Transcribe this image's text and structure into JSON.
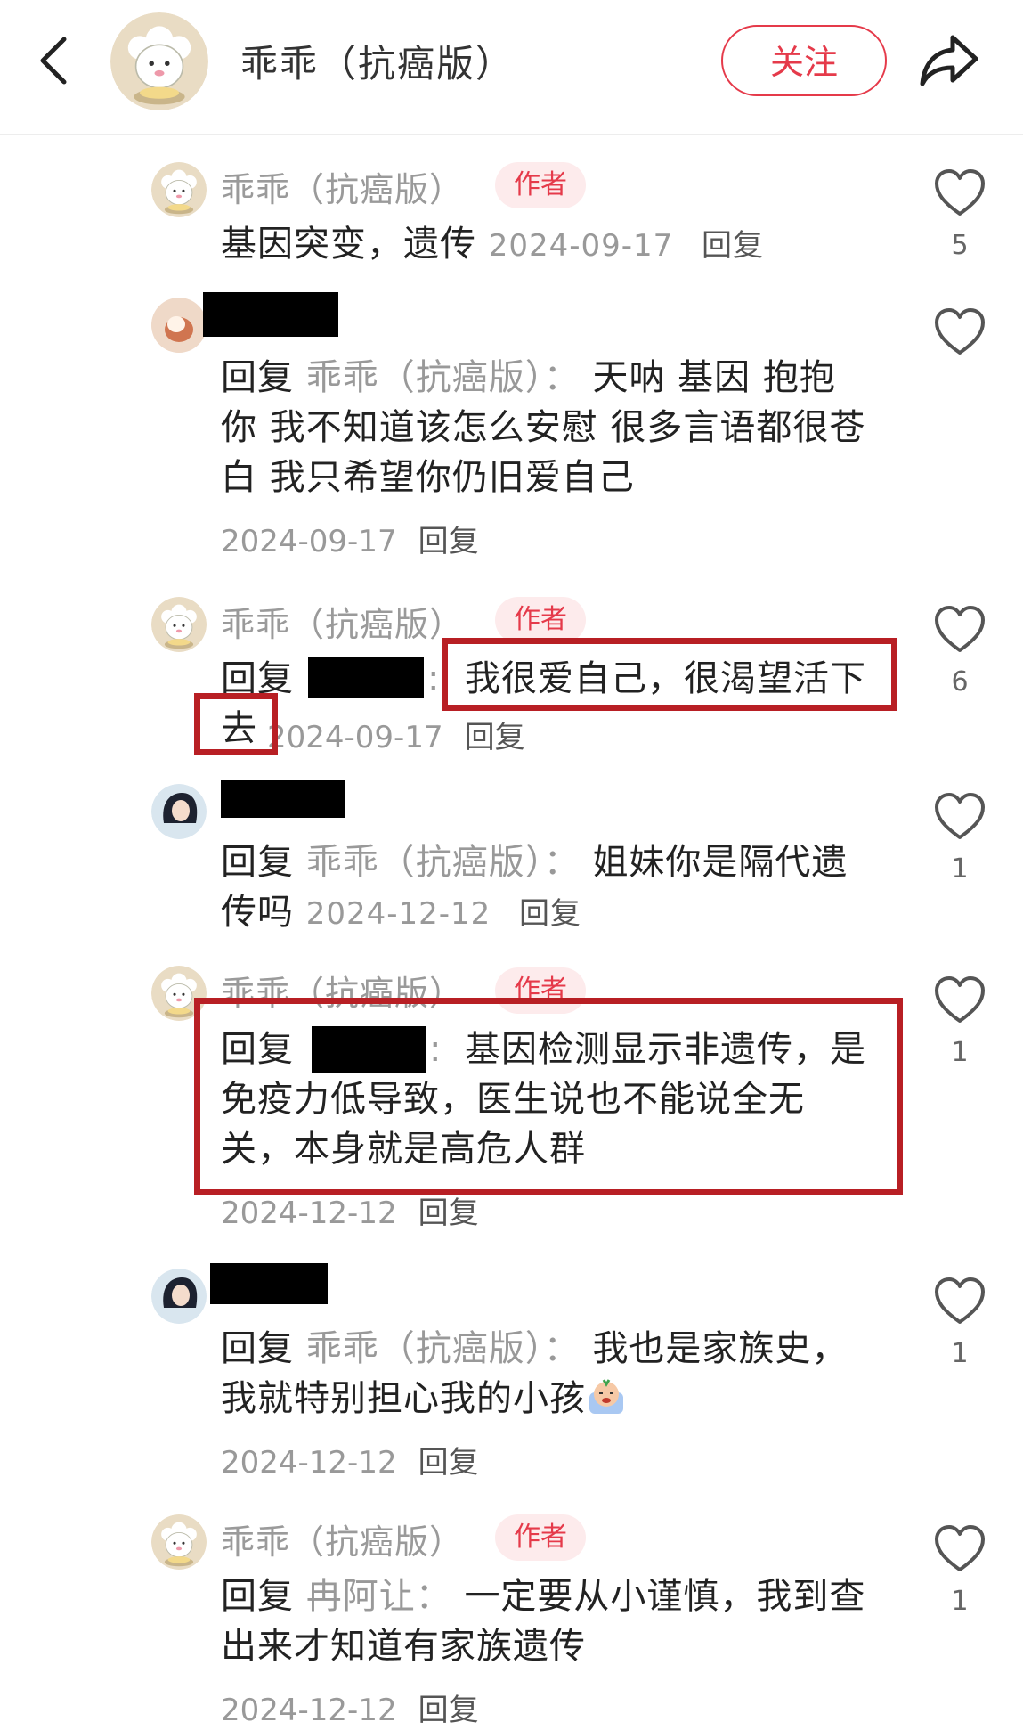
{
  "header": {
    "title": "乖乖（抗癌版）",
    "follow_label": "关注"
  },
  "comments": [
    {
      "author": "乖乖（抗癌版）",
      "tag": "作者",
      "text": "基因突变，遗传",
      "date": "2024-09-17",
      "reply_label": "回复",
      "likes": "5"
    },
    {
      "reply_prefix": "回复",
      "mention": "乖乖（抗癌版）",
      "lines": [
        "天呐 基因 抱抱",
        "你 我不知道该怎么安慰 很多言语都很苍",
        "白 我只希望你仍旧爱自己"
      ],
      "date": "2024-09-17",
      "reply_label": "回复"
    },
    {
      "author": "乖乖（抗癌版）",
      "tag": "作者",
      "reply_prefix": "回复",
      "line1": "我很爱自己，很渴望活下",
      "line2": "去",
      "date": "2024-09-17",
      "reply_label": "回复",
      "likes": "6"
    },
    {
      "reply_prefix": "回复",
      "mention": "乖乖（抗癌版）",
      "line1": "姐妹你是隔代遗",
      "line2": "传吗",
      "date": "2024-12-12",
      "reply_label": "回复",
      "likes": "1"
    },
    {
      "author": "乖乖（抗癌版）",
      "tag": "作者",
      "reply_prefix": "回复",
      "line1": "基因检测显示非遗传，是",
      "line2": "免疫力低导致，医生说也不能说全无",
      "line3": "关，本身就是高危人群",
      "date": "2024-12-12",
      "reply_label": "回复",
      "likes": "1"
    },
    {
      "reply_prefix": "回复",
      "mention": "乖乖（抗癌版）",
      "line1": "我也是家族史，",
      "line2": "我就特别担心我的小孩",
      "date": "2024-12-12",
      "reply_label": "回复",
      "likes": "1"
    },
    {
      "author": "乖乖（抗癌版）",
      "tag": "作者",
      "reply_prefix": "回复",
      "mention": "冉阿让",
      "line1": "一定要从小谨慎，我到查",
      "line2": "出来才知道有家族遗传",
      "date": "2024-12-12",
      "reply_label": "回复",
      "likes": "1"
    }
  ],
  "colors": {
    "accent": "#e53a4a",
    "highlight": "#b81f24",
    "muted": "#999999"
  },
  "icons": [
    "back-icon",
    "share-icon",
    "heart-icon",
    "crying-emoji-icon"
  ]
}
